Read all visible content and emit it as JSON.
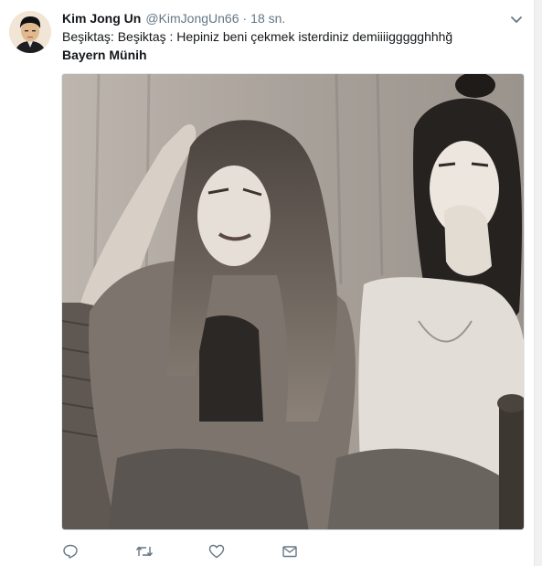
{
  "tweet": {
    "fullname": "Kim Jong Un",
    "username": "@KimJongUn66",
    "separator": "·",
    "timestamp": "18 sn.",
    "line1": "Beşiktaş: Beşiktaş : Hepiniz beni çekmek isterdiniz demiiiiggggghhhğ",
    "line2": "Bayern Münih"
  },
  "icons": {
    "caret": "chevron-down-icon",
    "reply": "reply-icon",
    "retweet": "retweet-icon",
    "like": "heart-icon",
    "dm": "envelope-icon"
  },
  "colors": {
    "text": "#14171a",
    "secondary": "#657786",
    "icon": "#657786",
    "border": "#e1e8ed"
  }
}
